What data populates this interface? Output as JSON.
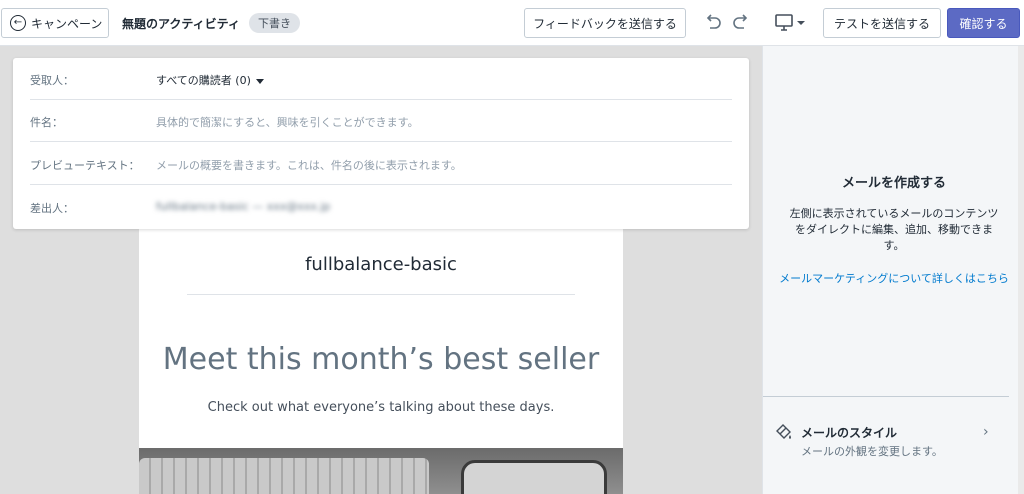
{
  "topbar": {
    "back_label": "キャンペーン",
    "title": "無題のアクティビティ",
    "badge": "下書き",
    "feedback_label": "フィードバックを送信する",
    "test_label": "テストを送信する",
    "confirm_label": "確認する",
    "icons": [
      "back-arrow-icon",
      "undo-icon",
      "redo-icon",
      "desktop-icon",
      "chevron-down-icon"
    ]
  },
  "fields": {
    "to_label": "受取人：",
    "to_value": "すべての購読者 (0)",
    "subject_label": "件名：",
    "subject_placeholder": "具体的で簡潔にすると、興味を引くことができます。",
    "preview_label": "プレビューテキスト：",
    "preview_placeholder": "メールの概要を書きます。これは、件名の後に表示されます。",
    "from_label": "差出人：",
    "from_value": "fullbalance-basic — xxx@xxx.jp"
  },
  "email": {
    "store_name": "fullbalance-basic",
    "headline": "Meet this month’s best seller",
    "subhead": "Check out what everyone’s talking about these days."
  },
  "sidebar": {
    "title": "メールを作成する",
    "description": "左側に表示されているメールのコンテンツをダイレクトに編集、追加、移動できます。",
    "link": "メールマーケティングについて詳しくはこちら",
    "style_title": "メールのスタイル",
    "style_desc": "メールの外観を変更します。"
  },
  "colors": {
    "accent": "#5c6ac4",
    "link": "#007ace",
    "badge_bg": "#dfe3e8"
  }
}
